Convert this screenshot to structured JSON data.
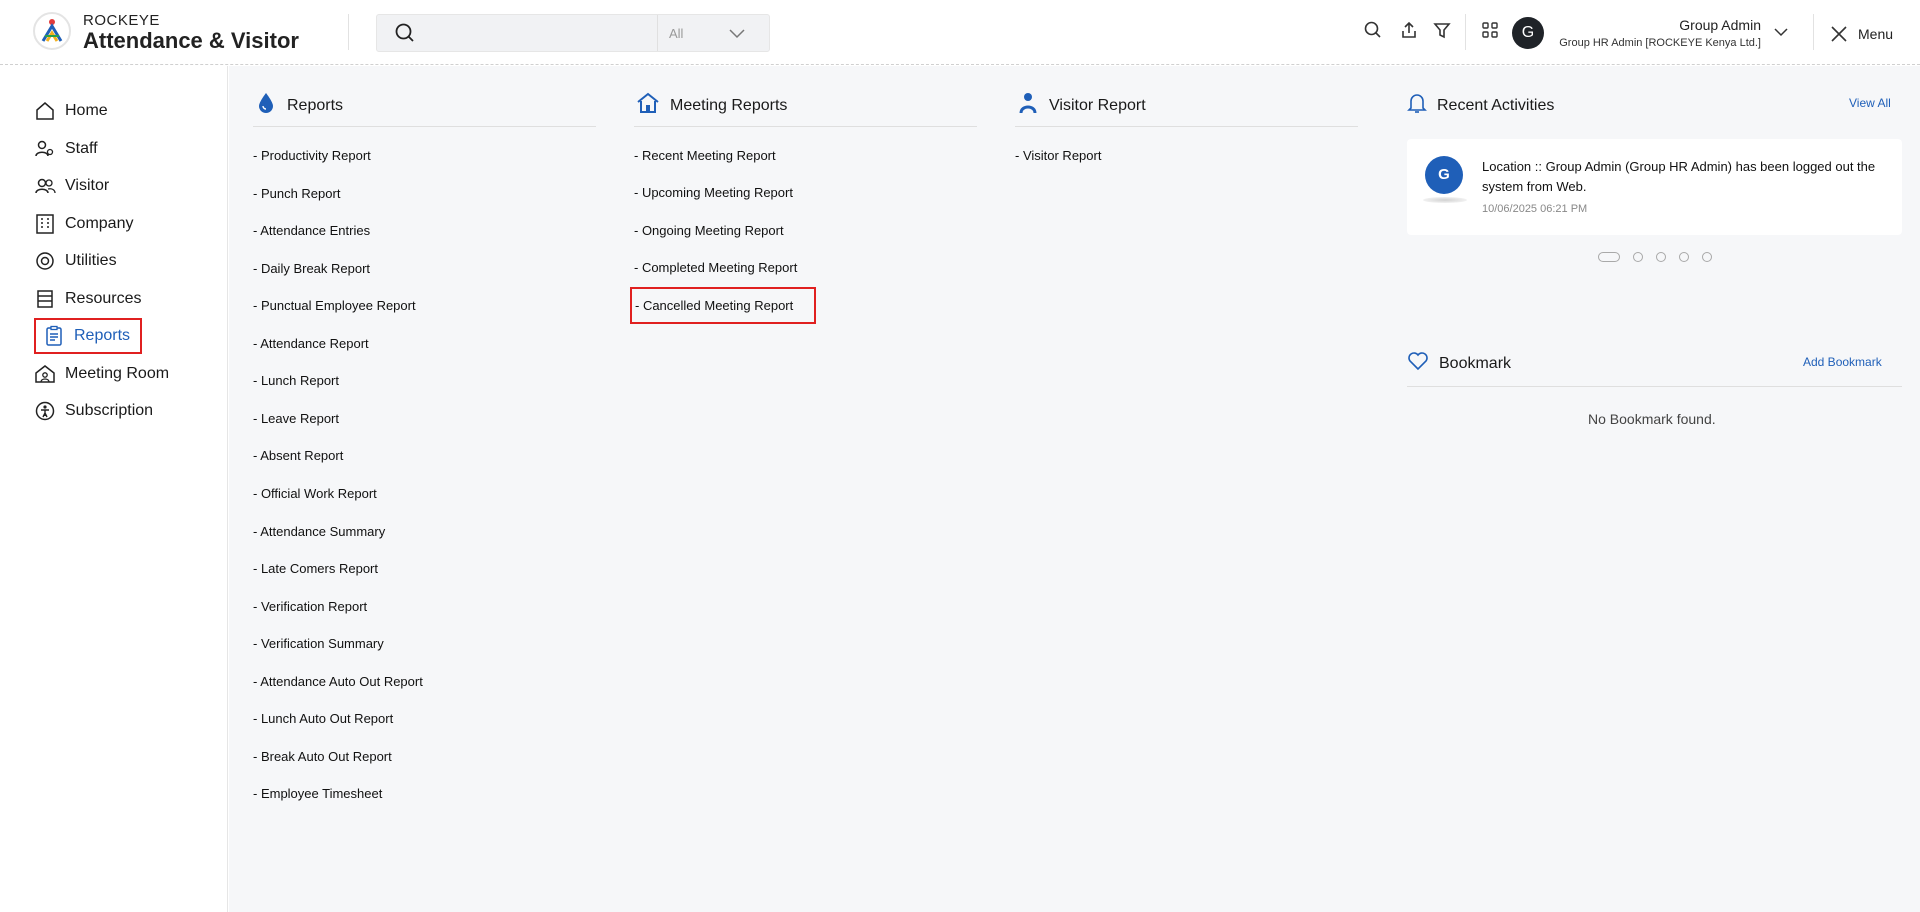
{
  "app": {
    "brand_top": "ROCKEYE",
    "brand_main": "Attendance & Visitor"
  },
  "header": {
    "search_placeholder": "",
    "search_scope": "All",
    "user_name": "Group Admin",
    "user_role": "Group HR Admin [ROCKEYE Kenya Ltd.]",
    "avatar_initial": "G",
    "menu_label": "Menu"
  },
  "sidebar": {
    "items": [
      {
        "label": "Home",
        "icon": "home-icon"
      },
      {
        "label": "Staff",
        "icon": "staff-icon"
      },
      {
        "label": "Visitor",
        "icon": "visitor-icon"
      },
      {
        "label": "Company",
        "icon": "company-icon"
      },
      {
        "label": "Utilities",
        "icon": "utilities-icon"
      },
      {
        "label": "Resources",
        "icon": "resources-icon"
      },
      {
        "label": "Reports",
        "icon": "reports-icon",
        "active": true
      },
      {
        "label": "Meeting Room",
        "icon": "meeting-room-icon"
      },
      {
        "label": "Subscription",
        "icon": "subscription-icon"
      }
    ]
  },
  "reports": {
    "title": "Reports",
    "items": [
      "- Productivity Report",
      "- Punch Report",
      "- Attendance Entries",
      "- Daily Break Report",
      "- Punctual Employee Report",
      "- Attendance Report",
      "- Lunch Report",
      "- Leave Report",
      "- Absent Report",
      "- Official Work Report",
      "- Attendance Summary",
      "- Late Comers Report",
      "- Verification Report",
      "- Verification Summary",
      "- Attendance Auto Out Report",
      "- Lunch Auto Out Report",
      "- Break Auto Out Report",
      "- Employee Timesheet"
    ]
  },
  "meeting_reports": {
    "title": "Meeting Reports",
    "items": [
      "- Recent Meeting Report",
      "- Upcoming Meeting Report",
      "- Ongoing Meeting Report",
      "- Completed Meeting Report",
      "- Cancelled Meeting Report"
    ]
  },
  "visitor_report": {
    "title": "Visitor Report",
    "items": [
      "- Visitor Report"
    ]
  },
  "recent_activities": {
    "title": "Recent Activities",
    "view_all": "View All",
    "activity": {
      "avatar": "G",
      "text": "Location :: Group Admin (Group HR Admin) has been logged out the system from Web.",
      "time": "10/06/2025 06:21 PM"
    },
    "pager_count": 5
  },
  "bookmark": {
    "title": "Bookmark",
    "add_label": "Add Bookmark",
    "empty_text": "No Bookmark found."
  },
  "colors": {
    "accent": "#1f5fb8",
    "highlight": "#e02020",
    "background": "#f6f7f9"
  }
}
